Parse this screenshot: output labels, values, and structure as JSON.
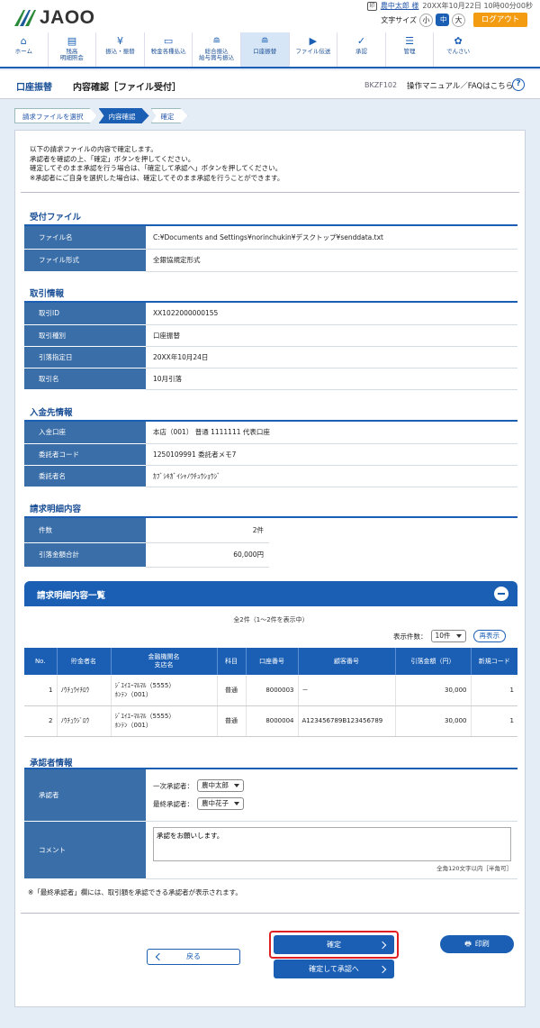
{
  "header": {
    "logo_text": "JAOO",
    "user_icon": "印",
    "user_name": "農中太郎 様",
    "datetime": "20XX年10月22日 10時00分00秒",
    "font_size_label": "文字サイズ",
    "font_sizes": [
      "小",
      "中",
      "大"
    ],
    "font_size_selected": "中",
    "logout_label": "ログアウト"
  },
  "nav": {
    "items": [
      {
        "icon": "home-icon",
        "label": "ホーム"
      },
      {
        "icon": "document-icon",
        "label": "残高\n明細照会"
      },
      {
        "icon": "yen-icon",
        "label": "振込・振替"
      },
      {
        "icon": "card-icon",
        "label": "税金各種払込"
      },
      {
        "icon": "coins-icon",
        "label": "総合振込\n給与賞与振込"
      },
      {
        "icon": "coins-icon",
        "label": "口座振替"
      },
      {
        "icon": "file-transfer-icon",
        "label": "ファイル伝送"
      },
      {
        "icon": "approval-icon",
        "label": "承認"
      },
      {
        "icon": "admin-icon",
        "label": "管理"
      },
      {
        "icon": "settings-icon",
        "label": "でんさい"
      }
    ],
    "active_index": 5
  },
  "titlebar": {
    "section": "口座振替",
    "page_title": "内容確認［ファイル受付］",
    "screen_code": "BKZF102",
    "help_label": "操作マニュアル／FAQはこちら"
  },
  "steps": [
    "請求ファイルを選択",
    "内容確認",
    "確定"
  ],
  "current_step": 1,
  "intro": [
    "以下の請求ファイルの内容で確定します。",
    "承認者を確認の上、「確定」ボタンを押してください。",
    "確定してそのまま承認を行う場合は、「確定して承認へ」ボタンを押してください。",
    "※承認者にご自身を選択した場合は、確定してそのまま承認を行うことができます。"
  ],
  "file_section": {
    "title": "受付ファイル",
    "rows": [
      {
        "label": "ファイル名",
        "value": "C:¥Documents and Settings¥norinchukin¥デスクトップ¥senddata.txt"
      },
      {
        "label": "ファイル形式",
        "value": "全銀協規定形式"
      }
    ]
  },
  "txn_section": {
    "title": "取引情報",
    "rows": [
      {
        "label": "取引ID",
        "value": "XX1022000000155"
      },
      {
        "label": "取引種別",
        "value": "口座振替"
      },
      {
        "label": "引落指定日",
        "value": "20XX年10月24日"
      },
      {
        "label": "取引名",
        "value": "10月引落"
      }
    ]
  },
  "payee_section": {
    "title": "入金先情報",
    "rows": [
      {
        "label": "入金口座",
        "value": "本店（001） 普通 1111111 代表口座"
      },
      {
        "label": "委託者コード",
        "value": "1250109991 委託者メモ7"
      },
      {
        "label": "委託者名",
        "value": "ｶﾌﾞｼｷｶﾞｲｼｬﾉｳﾁｭｳｼｮｳｼﾞ"
      }
    ]
  },
  "detail_section": {
    "title": "請求明細内容",
    "rows": [
      {
        "label": "件数",
        "value": "2件"
      },
      {
        "label": "引落金額合計",
        "value": "60,000円"
      }
    ]
  },
  "list_section": {
    "title": "請求明細内容一覧",
    "count_text": "全2件（1～2件を表示中）",
    "per_page_label": "表示件数：",
    "per_page_value": "10件",
    "redisplay_label": "再表示",
    "columns": [
      "No.",
      "貯金者名",
      "金融機関名\n支店名",
      "科目",
      "口座番号",
      "顧客番号",
      "引落金額（円）",
      "新規コード"
    ],
    "rows": [
      {
        "no": "1",
        "name": "ﾉｳﾁｭｳｲﾁﾛｳ",
        "bank": "ｼﾞｴｲｴｰﾏﾙﾏﾙ（5555）",
        "branch": "ﾎﾝﾃﾝ（001）",
        "subject": "普通",
        "account": "8000003",
        "customer": "－",
        "amount": "30,000",
        "code": "1"
      },
      {
        "no": "2",
        "name": "ﾉｳﾁｭｳｼﾞﾛｳ",
        "bank": "ｼﾞｴｲｴｰﾏﾙﾏﾙ（5555）",
        "branch": "ﾎﾝﾃﾝ（001）",
        "subject": "普通",
        "account": "8000004",
        "customer": "A123456789B123456789",
        "amount": "30,000",
        "code": "1"
      }
    ]
  },
  "approver_section": {
    "title": "承認者情報",
    "approver_label": "承認者",
    "first_label": "一次承認者：",
    "first_value": "農中太郎",
    "final_label": "最終承認者：",
    "final_value": "農中花子",
    "comment_label": "コメント",
    "comment_value": "承認をお願いします。",
    "comment_limit": "全角120文字以内［半角可］",
    "note": "※「最終承認者」欄には、取引額を承認できる承認者が表示されます。"
  },
  "buttons": {
    "back": "戻る",
    "confirm": "確定",
    "confirm_approve": "確定して承認へ",
    "print": "印刷"
  },
  "colors": {
    "primary": "#1a5fb4",
    "header_cell": "#3a6ea8",
    "logout": "#f39c12",
    "highlight_border": "#e02020"
  }
}
